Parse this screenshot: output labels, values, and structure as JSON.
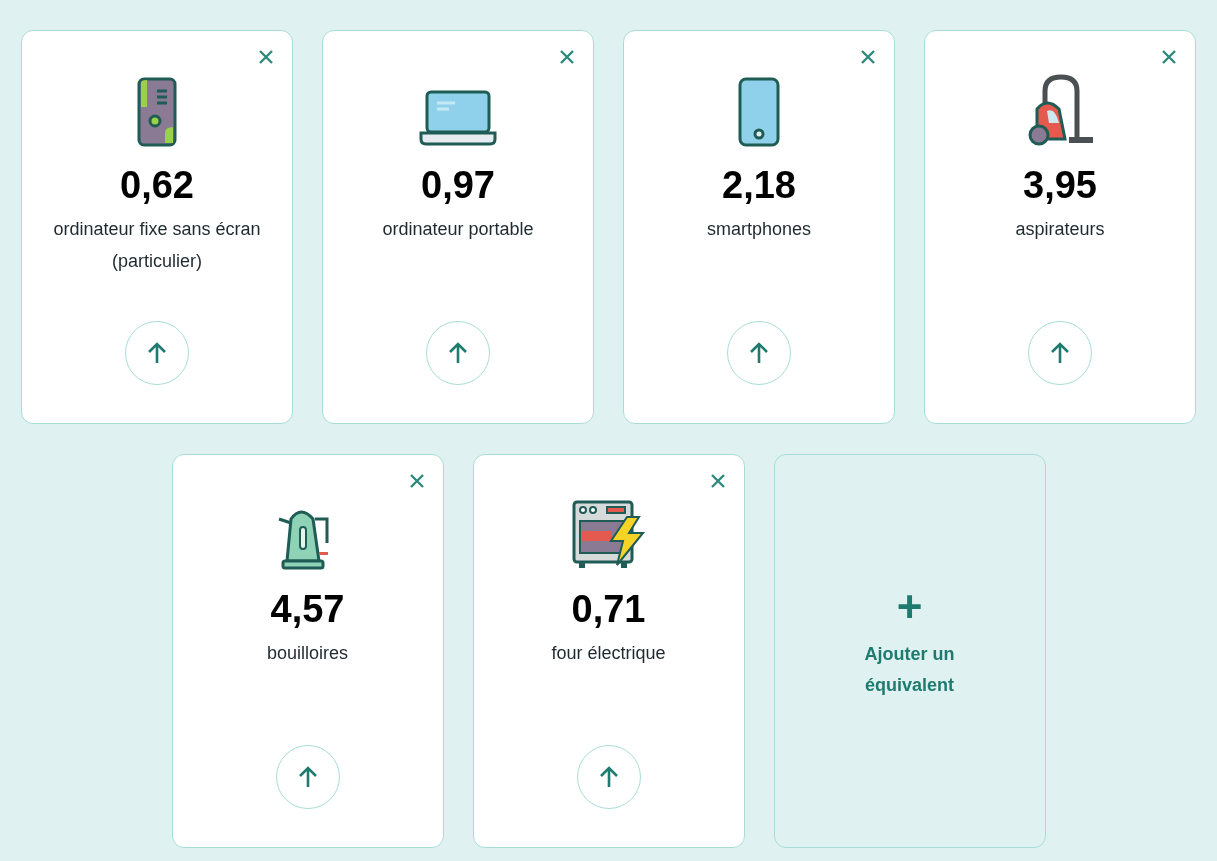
{
  "rows": [
    [
      {
        "kind": "desktop",
        "value": "0,62",
        "label": "ordinateur fixe sans écran (particulier)"
      },
      {
        "kind": "laptop",
        "value": "0,97",
        "label": "ordinateur portable"
      },
      {
        "kind": "smartphone",
        "value": "2,18",
        "label": "smartphones"
      },
      {
        "kind": "vacuum",
        "value": "3,95",
        "label": "aspirateurs"
      }
    ],
    [
      {
        "kind": "kettle",
        "value": "4,57",
        "label": "bouilloires"
      },
      {
        "kind": "oven",
        "value": "0,71",
        "label": "four électrique"
      },
      {
        "kind": "add",
        "symbol": "+",
        "label": "Ajouter un équivalent"
      }
    ]
  ]
}
